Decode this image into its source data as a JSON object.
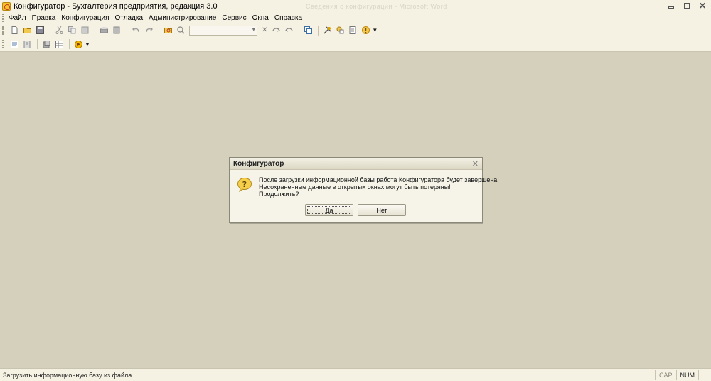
{
  "window": {
    "title": "Конфигуратор - Бухгалтерия предприятия, редакция 3.0",
    "ghost_title": "Сведения о конфигурации - Microsoft Word"
  },
  "menu": {
    "items": [
      {
        "label": "Файл"
      },
      {
        "label": "Правка"
      },
      {
        "label": "Конфигурация"
      },
      {
        "label": "Отладка"
      },
      {
        "label": "Администрирование"
      },
      {
        "label": "Сервис"
      },
      {
        "label": "Окна"
      },
      {
        "label": "Справка"
      }
    ]
  },
  "toolbar1": {
    "icons": [
      "new-doc-icon",
      "open-folder-icon",
      "save-icon",
      "cut-icon",
      "copy-icon",
      "paste-icon",
      "print-icon",
      "print-preview-icon",
      "undo-icon",
      "redo-icon",
      "find-folder-icon",
      "find-icon",
      "search-combo",
      "clear-search-icon",
      "find-next-icon",
      "find-prev-icon",
      "windows-icon",
      "tools-icon",
      "syntax-helper-icon",
      "properties-icon",
      "info-icon"
    ]
  },
  "toolbar2": {
    "icons": [
      "config-window-icon",
      "module-icon",
      "db-config-icon",
      "grid-icon",
      "run-debug-icon"
    ]
  },
  "dialog": {
    "title": "Конфигуратор",
    "message_line1": "После загрузки информационной базы работа Конфигуратора будет завершена.",
    "message_line2": "Несохраненные данные в открытых окнах могут быть потеряны!",
    "message_line3": "Продолжить?",
    "yes_label": "Да",
    "no_label": "Нет"
  },
  "statusbar": {
    "text": "Загрузить информационную базу из файла",
    "cap": "CAP",
    "num": "NUM"
  },
  "colors": {
    "workspace": "#d4d0bc",
    "chrome": "#f5f2e4",
    "dialog_bg": "#f6f4e8"
  }
}
